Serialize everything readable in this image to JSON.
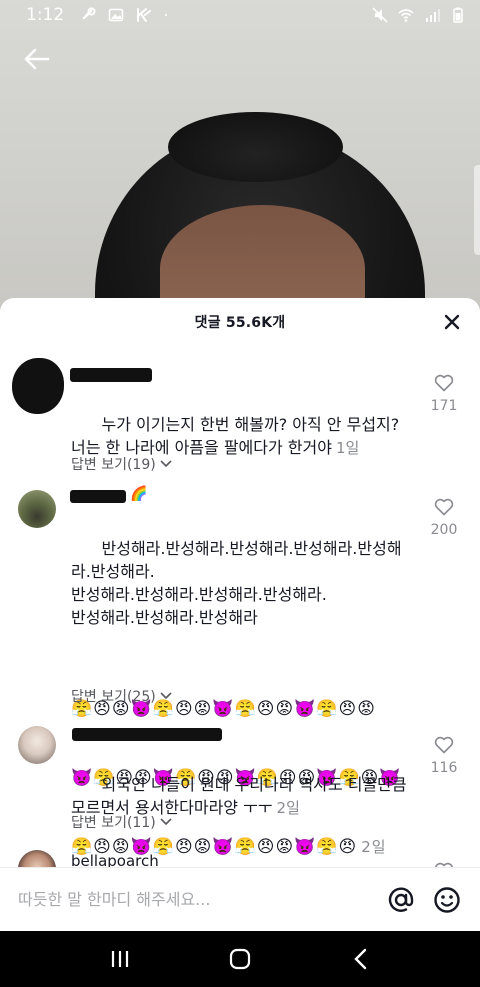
{
  "status_bar": {
    "time": "1:12",
    "icons_left": [
      "link-icon",
      "image-icon",
      "k-app-icon",
      "dot-icon"
    ],
    "icons_right": [
      "mute-icon",
      "wifi-icon",
      "signal-icon",
      "battery-icon"
    ]
  },
  "sheet": {
    "title": "댓글 55.6K개"
  },
  "comments": [
    {
      "text": "누가 이기는지 한번 해볼까? 아직 안 무섭지?\n너는 한 나라에 아픔을 팔에다가 한거야",
      "date": "1일",
      "likes": "171",
      "replies": "답변 보기(19)"
    },
    {
      "text": "반성해라.반성해라.반성해라.반성해라.반성해\n라.반성해라.\n반성해라.반성해라.반성해라.반성해라.\n반성해라.반성해라.반성해라",
      "emoji_rows": [
        "😤😠😡👿😤😠😡👿😤😠😡👿😤😠😡",
        "👿😤😠😡👿😤😠😡👿😤😠😡👿😤😡👿",
        "😤😠😡👿😤😠😡👿😤😠😡👿😤😠"
      ],
      "date": "2일",
      "likes": "200",
      "replies": "답변 보기(25)",
      "name_emoji": "🌈"
    },
    {
      "text": "외국인 니들이 뭔데 우리나라 역사도 티끌만큼\n모르면서 용서한다마라양 ㅜㅜ",
      "date": "2일",
      "likes": "116",
      "replies": "답변 보기(11)"
    },
    {
      "username": "bellapoarch"
    }
  ],
  "input": {
    "placeholder": "따듯한 말 한마디 해주세요..."
  },
  "colors": {
    "text": "#161823",
    "muted": "#8a8b91",
    "sheet_bg": "#ffffff"
  }
}
